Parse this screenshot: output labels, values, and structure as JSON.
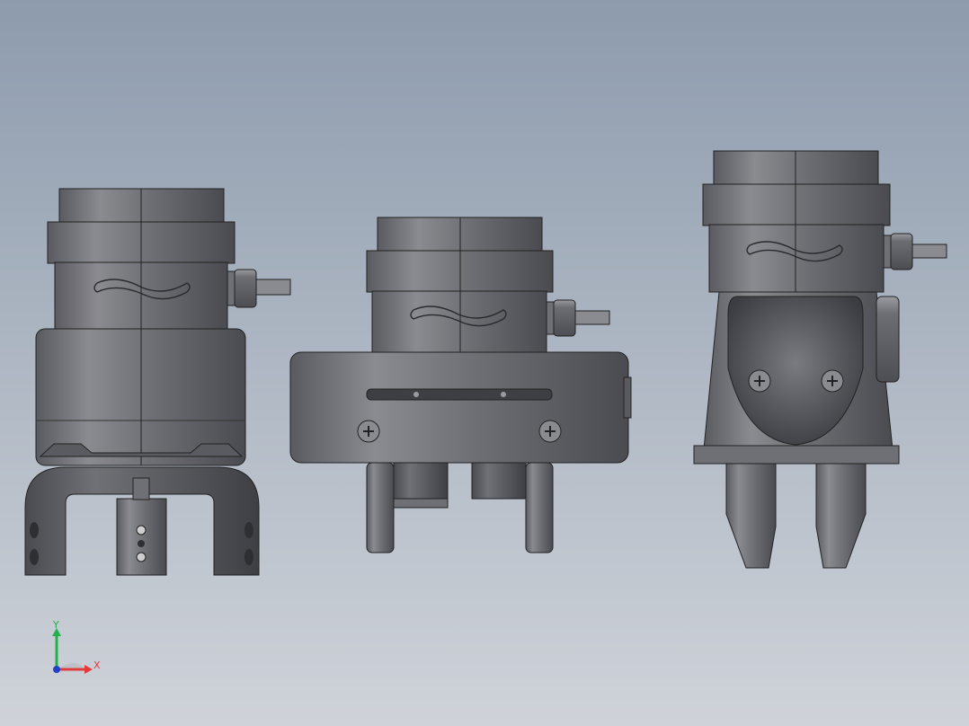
{
  "viewport": {
    "background_top": "#8d9bad",
    "background_bottom": "#cfd3d9"
  },
  "models": [
    {
      "name": "gripper-view-left"
    },
    {
      "name": "gripper-view-center"
    },
    {
      "name": "gripper-view-right"
    }
  ],
  "triad": {
    "y_label": "Y",
    "x_label": "X",
    "y_color": "#22b14c",
    "x_color": "#e03c3c",
    "z_color": "#2340c8"
  }
}
